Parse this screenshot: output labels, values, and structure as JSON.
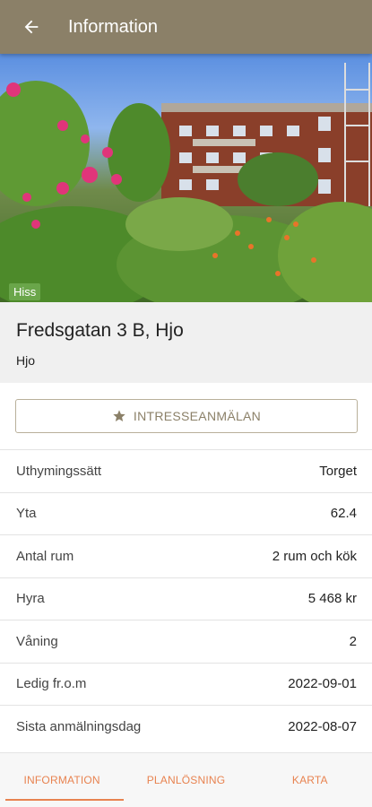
{
  "appbar": {
    "title": "Information",
    "back_icon": "arrow-left-icon"
  },
  "hero": {
    "tag": "Hiss"
  },
  "listing": {
    "address": "Fredsgatan 3 B, Hjo",
    "city": "Hjo"
  },
  "interest_button": {
    "label": "INTRESSEANMÄLAN",
    "icon": "star-icon"
  },
  "details": [
    {
      "label": "Uthymingssätt",
      "value": "Torget"
    },
    {
      "label": "Yta",
      "value": "62.4"
    },
    {
      "label": "Antal rum",
      "value": "2 rum och kök"
    },
    {
      "label": "Hyra",
      "value": "5 468 kr"
    },
    {
      "label": "Våning",
      "value": "2"
    },
    {
      "label": "Ledig fr.o.m",
      "value": "2022-09-01"
    },
    {
      "label": "Sista anmälningsdag",
      "value": "2022-08-07"
    }
  ],
  "tabs": [
    {
      "label": "INFORMATION",
      "active": true
    },
    {
      "label": "PLANLÖSNING",
      "active": false
    },
    {
      "label": "KARTA",
      "active": false
    }
  ],
  "colors": {
    "appbar": "#8b8068",
    "accent": "#e88350",
    "tag": "#6aa64a"
  }
}
